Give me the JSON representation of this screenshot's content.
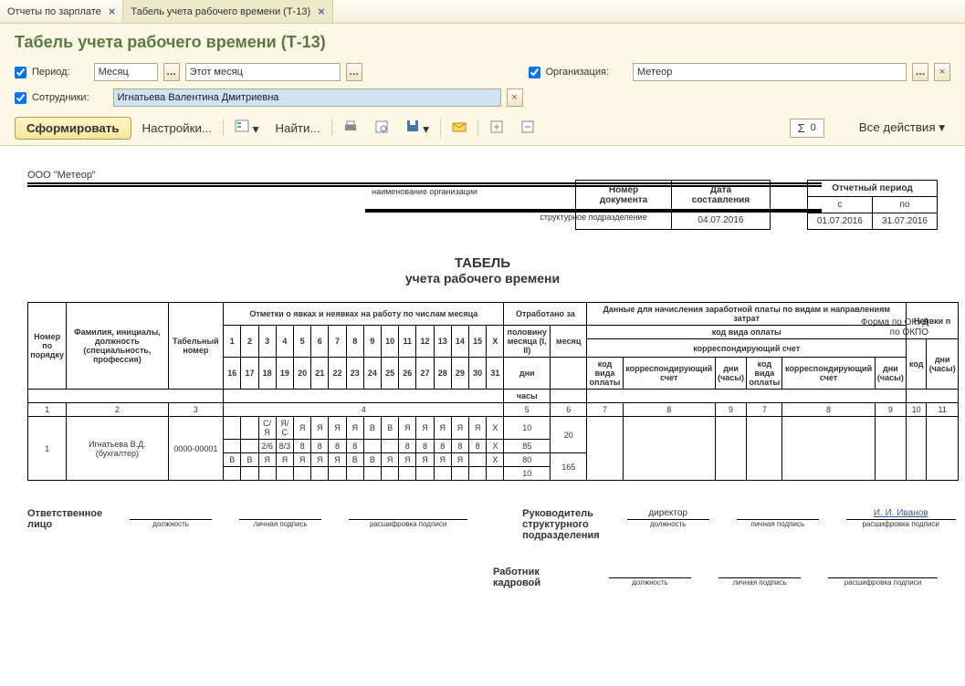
{
  "tabs": [
    {
      "label": "Отчеты по зарплате"
    },
    {
      "label": "Табель учета рабочего времени (Т-13)"
    }
  ],
  "page_title": "Табель учета рабочего времени (Т-13)",
  "filters": {
    "period_label": "Период:",
    "period_mode": "Месяц",
    "period_value": "Этот месяц",
    "org_label": "Организация:",
    "org_value": "Метеор",
    "emp_label": "Сотрудники:",
    "emp_value": "Игнатьева Валентина Дмитриевна"
  },
  "toolbar": {
    "generate": "Сформировать",
    "settings": "Настройки...",
    "find": "Найти...",
    "all_actions": "Все действия",
    "sigma_value": "0"
  },
  "report": {
    "org_name": "ООО \"Метеор\"",
    "org_cap": "наименование организации",
    "sub_cap": "структурное подразделение",
    "right_info1": "Форма по ОКУД",
    "right_info2": "по ОКПО",
    "doc_title": "ТАБЕЛЬ",
    "doc_sub": "учета  рабочего времени",
    "doc_no_hdr": "Номер документа",
    "doc_date_hdr": "Дата составления",
    "doc_date": "04.07.2016",
    "rep_period_hdr": "Отчетный период",
    "rep_from_hdr": "с",
    "rep_to_hdr": "по",
    "rep_from": "01.07.2016",
    "rep_to": "31.07.2016",
    "cols": {
      "num": "Номер по порядку",
      "fio": "Фамилия, инициалы, должность (специальность, профессия)",
      "tabnum": "Табельный номер",
      "marks": "Отметки о явках и неявках на работу по числам месяца",
      "worked": "Отработано за",
      "half": "половину месяца (I, II)",
      "month": "месяц",
      "days": "дни",
      "hours": "часы",
      "salary": "Данные для начисления заработной платы по видам и направлениям затрат",
      "paycode": "код вида оплаты",
      "corracc": "корреспондирующий счет",
      "daysh": "дни (часы)",
      "abs": "Неявки п",
      "code": "код"
    },
    "day_nums_1": [
      "1",
      "2",
      "3",
      "4",
      "5",
      "6",
      "7",
      "8",
      "9",
      "10",
      "11",
      "12",
      "13",
      "14",
      "15",
      "X"
    ],
    "day_nums_2": [
      "16",
      "17",
      "18",
      "19",
      "20",
      "21",
      "22",
      "23",
      "24",
      "25",
      "26",
      "27",
      "28",
      "29",
      "30",
      "31"
    ],
    "idx_row": [
      "1",
      "2",
      "3",
      "4",
      "5",
      "6",
      "7",
      "8",
      "9",
      "7",
      "8",
      "9",
      "10",
      "11"
    ],
    "emp": {
      "num": "1",
      "fio": "Игнатьева В.Д. (бухгалтер)",
      "tab": "0000-00001",
      "r1": [
        "",
        "",
        "С/Я",
        "Я/С",
        "Я",
        "Я",
        "Я",
        "Я",
        "В",
        "В",
        "Я",
        "Я",
        "Я",
        "Я",
        "Я",
        "X"
      ],
      "r2": [
        "",
        "",
        "2/6",
        "8/3",
        "8",
        "8",
        "8",
        "8",
        "",
        "",
        "8",
        "8",
        "8",
        "8",
        "8",
        "X"
      ],
      "r3": [
        "В",
        "В",
        "Я",
        "Я",
        "Я",
        "Я",
        "Я",
        "В",
        "В",
        "Я",
        "Я",
        "Я",
        "Я",
        "Я",
        "",
        "X"
      ],
      "r4": [
        "",
        "",
        "",
        "",
        "",
        "",
        "",
        "",
        "",
        "",
        "",
        "",
        "",
        "",
        "",
        ""
      ],
      "half_days": "10",
      "half_hours": "85",
      "m2_days": "80",
      "m2_hours": "10",
      "month_days": "20",
      "month_hours": "165"
    },
    "sign": {
      "resp": "Ответственное лицо",
      "pos": "должность",
      "sig": "личная подпись",
      "decrypt": "расшифровка подписи",
      "head": "Руководитель структурного подразделения",
      "head_pos": "директор",
      "head_name": "И. И. Иванов",
      "hr": "Работник кадровой"
    }
  }
}
